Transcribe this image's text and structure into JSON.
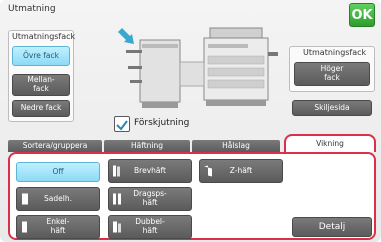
{
  "header": {
    "title": "Utmatning",
    "ok_label": "OK"
  },
  "left_panel": {
    "label": "Utmatningsfack",
    "items": [
      {
        "label": "Övre fack",
        "selected": true
      },
      {
        "label": "Mellan-\nfack",
        "selected": false
      },
      {
        "label": "Nedre fack",
        "selected": false
      }
    ]
  },
  "right_panel": {
    "label": "Utmatningsfack",
    "item": {
      "label": "Höger\nfack"
    }
  },
  "offset": {
    "label": "Förskjutning",
    "checked": true
  },
  "separator_button": "Skiljesida",
  "tabs": [
    {
      "label": "Sortera/gruppera",
      "active": false
    },
    {
      "label": "Häftning",
      "active": false
    },
    {
      "label": "Hålslag",
      "active": false
    },
    {
      "label": "Vikning",
      "active": true
    }
  ],
  "fold_options": [
    {
      "label": "Off",
      "selected": true
    },
    {
      "label": "Brevhäft",
      "selected": false
    },
    {
      "label": "Z-häft",
      "selected": false
    },
    {
      "label": "Sadelh.",
      "selected": false
    },
    {
      "label": "Dragsps-\nhäft",
      "selected": false
    },
    {
      "label": "Enkel-\nhäft",
      "selected": false
    },
    {
      "label": "Dubbel-\nhäft",
      "selected": false
    }
  ],
  "detail_button": "Detalj",
  "colors": {
    "accent": "#d8324a",
    "ok_green": "#2e9d2e",
    "selected_blue": "#8ddaf5"
  }
}
